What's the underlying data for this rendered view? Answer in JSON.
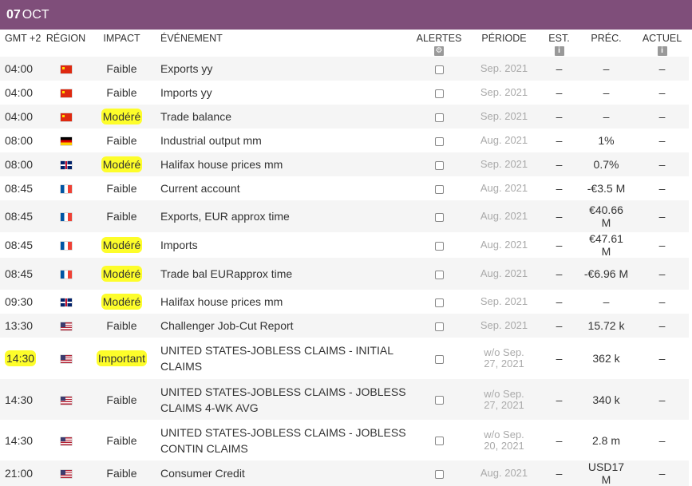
{
  "header": {
    "day": "07",
    "month": "OCT"
  },
  "columns": {
    "gmt": "GMT +2",
    "region": "RÉGION",
    "impact": "IMPACT",
    "event": "ÉVÉNEMENT",
    "alerts": "ALERTES",
    "period": "PÉRIODE",
    "est": "EST.",
    "prev": "PRÉC.",
    "actual": "ACTUEL"
  },
  "icons": {
    "alerts": "gear-icon",
    "est": "info-icon",
    "actual": "info-icon"
  },
  "highlight_color": "#fdfd2a",
  "rows": [
    {
      "time": "04:00",
      "region": "cn",
      "impact": "Faible",
      "event": "Exports yy",
      "period": "Sep. 2021",
      "est": "–",
      "prev": "–",
      "actual": "–"
    },
    {
      "time": "04:00",
      "region": "cn",
      "impact": "Faible",
      "event": "Imports yy",
      "period": "Sep. 2021",
      "est": "–",
      "prev": "–",
      "actual": "–"
    },
    {
      "time": "04:00",
      "region": "cn",
      "impact": "Modéré",
      "event": "Trade balance",
      "period": "Sep. 2021",
      "est": "–",
      "prev": "–",
      "actual": "–"
    },
    {
      "time": "08:00",
      "region": "de",
      "impact": "Faible",
      "event": "Industrial output mm",
      "period": "Aug. 2021",
      "est": "–",
      "prev": "1%",
      "actual": "–"
    },
    {
      "time": "08:00",
      "region": "gb",
      "impact": "Modéré",
      "event": "Halifax house prices mm",
      "period": "Sep. 2021",
      "est": "–",
      "prev": "0.7%",
      "actual": "–"
    },
    {
      "time": "08:45",
      "region": "fr",
      "impact": "Faible",
      "event": "Current account",
      "period": "Aug. 2021",
      "est": "–",
      "prev": "-€3.5 M",
      "actual": "–"
    },
    {
      "time": "08:45",
      "region": "fr",
      "impact": "Faible",
      "event": "Exports, EUR approx time",
      "period": "Aug. 2021",
      "est": "–",
      "prev": "€40.66 M",
      "actual": "–"
    },
    {
      "time": "08:45",
      "region": "fr",
      "impact": "Modéré",
      "event": "Imports",
      "period": "Aug. 2021",
      "est": "–",
      "prev": "€47.61 M",
      "actual": "–"
    },
    {
      "time": "08:45",
      "region": "fr",
      "impact": "Modéré",
      "event": "Trade bal EURapprox time",
      "period": "Aug. 2021",
      "est": "–",
      "prev": "-€6.96 M",
      "actual": "–"
    },
    {
      "time": "09:30",
      "region": "gb",
      "impact": "Modéré",
      "event": "Halifax house prices mm",
      "period": "Sep. 2021",
      "est": "–",
      "prev": "–",
      "actual": "–"
    },
    {
      "time": "13:30",
      "region": "us",
      "impact": "Faible",
      "event": "Challenger Job-Cut Report",
      "period": "Sep. 2021",
      "est": "–",
      "prev": "15.72 k",
      "actual": "–"
    },
    {
      "time": "14:30",
      "region": "us",
      "impact": "Important",
      "event": "UNITED STATES-JOBLESS CLAIMS - INITIAL CLAIMS",
      "period": "w/o Sep. 27, 2021",
      "est": "–",
      "prev": "362 k",
      "actual": "–"
    },
    {
      "time": "14:30",
      "region": "us",
      "impact": "Faible",
      "event": "UNITED STATES-JOBLESS CLAIMS - JOBLESS CLAIMS 4-WK AVG",
      "period": "w/o Sep. 27, 2021",
      "est": "–",
      "prev": "340 k",
      "actual": "–"
    },
    {
      "time": "14:30",
      "region": "us",
      "impact": "Faible",
      "event": "UNITED STATES-JOBLESS CLAIMS - JOBLESS CONTIN CLAIMS",
      "period": "w/o Sep. 20, 2021",
      "est": "–",
      "prev": "2.8 m",
      "actual": "–"
    },
    {
      "time": "21:00",
      "region": "us",
      "impact": "Faible",
      "event": "Consumer Credit",
      "period": "Aug. 2021",
      "est": "–",
      "prev": "USD17 M",
      "actual": "–"
    }
  ]
}
